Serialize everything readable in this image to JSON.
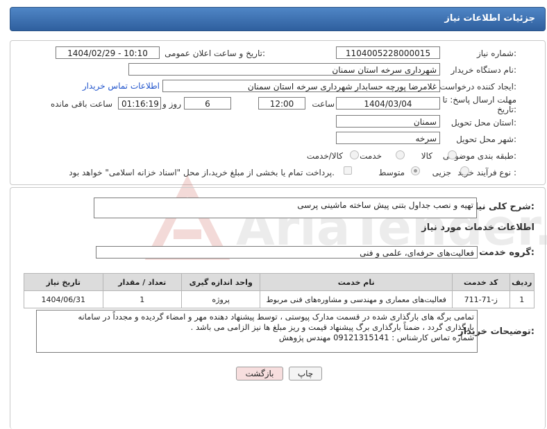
{
  "title": "جزئیات اطلاعات نیاز",
  "fields": {
    "need_number_label": "شماره نیاز:",
    "need_number": "1104005228000015",
    "announce_label": "تاریخ و ساعت اعلان عمومی:",
    "announce_value": "1404/02/29 - 10:10",
    "buyer_org_label": "نام دستگاه خریدار:",
    "buyer_org": "شهرداری سرخه استان سمنان",
    "creator_label": "ایجاد کننده درخواست:",
    "creator": "غلامرضا پورچه حسابدار شهرداری سرخه استان سمنان",
    "contact_link": "اطلاعات تماس خریدار",
    "deadline_label_1": "مهلت ارسال پاسخ: تا",
    "deadline_label_2": "تاریخ:",
    "deadline_date": "1404/03/04",
    "time_label": "ساعت",
    "deadline_time": "12:00",
    "days_value": "6",
    "days_label": "روز و",
    "remaining_time": "01:16:19",
    "remaining_label": "ساعت باقی مانده",
    "province_label": "استان محل تحویل:",
    "province": "سمنان",
    "city_label": "شهر محل تحویل:",
    "city": "سرخه",
    "category_label": "طبقه بندی موضوعی:",
    "category_options": [
      "کالا",
      "خدمت",
      "کالا/خدمت"
    ],
    "process_label": "نوع فرآیند خرید :",
    "process_options": [
      "جزیی",
      "متوسط"
    ],
    "payment_note": "پرداخت تمام یا بخشی از مبلغ خرید،از محل \"اسناد خزانه اسلامی\" خواهد بود."
  },
  "summary": {
    "label": "شرح کلی نیاز:",
    "value": "تهیه و نصب جداول بتنی پیش ساخته ماشینی پرسی"
  },
  "services": {
    "heading": "اطلاعات خدمات مورد نیاز",
    "group_label": "گروه خدمت:",
    "group_value": "فعالیت‌های حرفه‌ای، علمی و فنی",
    "columns": [
      "ردیف",
      "کد خدمت",
      "نام خدمت",
      "واحد اندازه گیری",
      "تعداد / مقدار",
      "تاریخ نیاز"
    ],
    "rows": [
      {
        "idx": "1",
        "code": "ز-71-711",
        "name": "فعالیت‌های معماری و مهندسی و مشاوره‌های فنی مربوط",
        "unit": "پروژه",
        "qty": "1",
        "date": "1404/06/31"
      }
    ]
  },
  "description": {
    "label": "توضیحات خریدار:",
    "lines": [
      "تمامی برگه های بارگذاری شده در قسمت مدارک پیوستی ، توسط پیشنهاد دهنده مهر و امضاء گردیده و مجدداً در سامانه",
      "بارگذاری گردد ، ضمناً بارگذاری برگ پیشنهاد قیمت و ریز مبلغ ها نیز الزامی می باشد .",
      "شماره تماس کارشناس : 09121315141 مهندس پژوهش"
    ]
  },
  "buttons": {
    "print": "چاپ",
    "back": "بازگشت"
  },
  "watermark": "AriaTender.neT",
  "colors": {
    "header": "#3a6db0",
    "link": "#2255cc",
    "back_button": "#f7dede"
  }
}
